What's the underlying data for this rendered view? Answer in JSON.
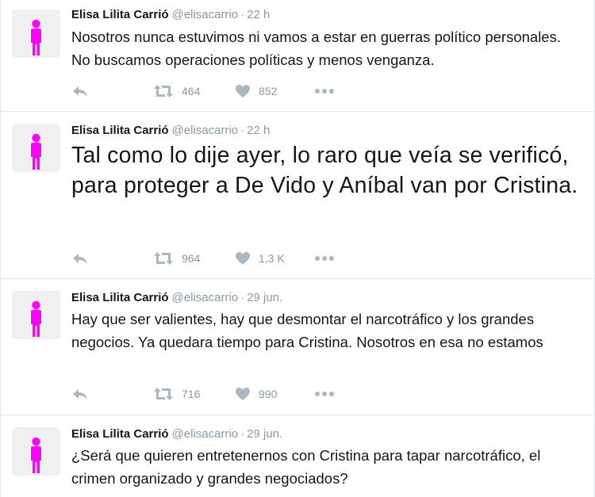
{
  "tweets": [
    {
      "name": "Elisa Lilita Carrió",
      "handle": "@elisacarrio",
      "separator": "·",
      "time": "22 h",
      "text": "Nosotros nunca estuvimos ni vamos a estar en guerras político personales. No buscamos operaciones políticas y menos venganza.",
      "retweets": "464",
      "likes": "852"
    },
    {
      "name": "Elisa Lilita Carrió",
      "handle": "@elisacarrio",
      "separator": "·",
      "time": "22 h",
      "text": "Tal como lo dije ayer, lo raro que veía se verificó, para proteger a De Vido y Aníbal van por Cristina.",
      "retweets": "964",
      "likes": "1,3 K"
    },
    {
      "name": "Elisa Lilita Carrió",
      "handle": "@elisacarrio",
      "separator": "·",
      "time": "29 jun.",
      "text": "Hay que ser valientes, hay que desmontar el narcotráfico y los grandes negocios. Ya quedara tiempo para Cristina. Nosotros en esa no estamos",
      "retweets": "716",
      "likes": "990"
    },
    {
      "name": "Elisa Lilita Carrió",
      "handle": "@elisacarrio",
      "separator": "·",
      "time": "29 jun.",
      "text": "¿Será que quieren entretenernos con Cristina para tapar narcotráfico, el crimen organizado y grandes negociados?",
      "retweets": "",
      "likes": ""
    }
  ],
  "icons": {
    "avatar": "pink-person-silhouette-icon",
    "reply": "reply-arrow-icon",
    "retweet": "retweet-icon",
    "like": "heart-icon",
    "more": "more-dots-icon"
  },
  "colors": {
    "avatar_figure": "#ff00ff",
    "avatar_bg": "#f0f0f0",
    "icon_gray": "#aab8c2",
    "meta_gray": "#8899a6",
    "divider": "#e1e8ed"
  }
}
